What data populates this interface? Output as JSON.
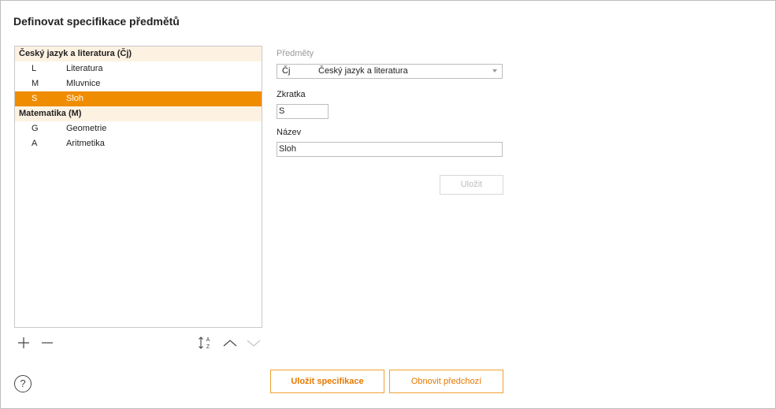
{
  "title": "Definovat specifikace předmětů",
  "list": {
    "groups": [
      {
        "label": "Český jazyk a literatura (Čj)",
        "items": [
          {
            "abbr": "L",
            "name": "Literatura"
          },
          {
            "abbr": "M",
            "name": "Mluvnice"
          },
          {
            "abbr": "S",
            "name": "Sloh",
            "selected": true
          }
        ]
      },
      {
        "label": "Matematika (M)",
        "items": [
          {
            "abbr": "G",
            "name": "Geometrie"
          },
          {
            "abbr": "A",
            "name": "Aritmetika"
          }
        ]
      }
    ]
  },
  "toolbar": {
    "icons": [
      "plus-icon",
      "minus-icon",
      "sort-az-icon",
      "chevron-up-icon",
      "chevron-down-icon"
    ]
  },
  "form": {
    "subjects_label": "Předměty",
    "subject_code": "Čj",
    "subject_name": "Český jazyk a literatura",
    "abbr_label": "Zkratka",
    "abbr_value": "S",
    "name_label": "Název",
    "name_value": "Sloh",
    "save_label": "Uložit"
  },
  "footer": {
    "help_icon": "help-icon",
    "help_glyph": "?",
    "save_spec_label": "Uložit specifikace",
    "restore_label": "Obnovit předchozí"
  },
  "colors": {
    "accent": "#f08c00",
    "group_bg": "#fdf2e2"
  }
}
